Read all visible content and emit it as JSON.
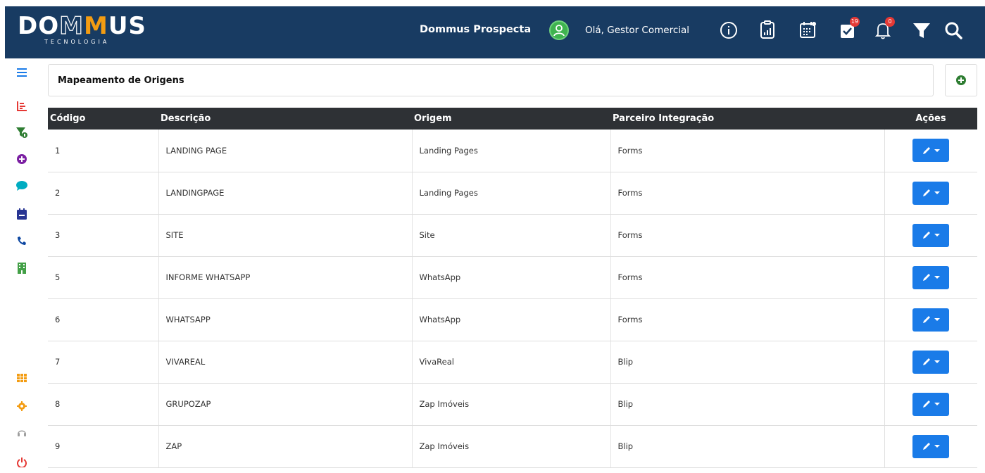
{
  "header": {
    "logo_main_pre": "DO",
    "logo_main_m1": "M",
    "logo_main_m2": "M",
    "logo_main_post": "US",
    "logo_sub": "TECNOLOGIA",
    "app_name": "Dommus Prospecta",
    "greeting": "Olá, Gestor Comercial",
    "icons": [
      "user-avatar-icon",
      "info-icon",
      "report-icon",
      "calendar-icon",
      "task-check-icon",
      "bell-icon",
      "filter-icon",
      "search-icon"
    ],
    "task_badge": "19",
    "notif_badge": "0"
  },
  "sidebar": {
    "items": [
      {
        "icon": "menu-icon",
        "color": "#1a7be8"
      },
      {
        "icon": "chart-icon",
        "color": "#e53935"
      },
      {
        "icon": "funnel-icon",
        "color": "#2e7d32"
      },
      {
        "icon": "plus-circle-icon",
        "color": "#7b1fa2"
      },
      {
        "icon": "chat-icon",
        "color": "#00acc1"
      },
      {
        "icon": "calendar-icon",
        "color": "#283593"
      },
      {
        "icon": "phone-icon",
        "color": "#0d47a1"
      },
      {
        "icon": "building-icon",
        "color": "#43a047"
      },
      {
        "icon": "table-icon",
        "color": "#f39c12"
      },
      {
        "icon": "gear-icon",
        "color": "#f39c12"
      },
      {
        "icon": "headset-icon",
        "color": "#9e9e9e"
      },
      {
        "icon": "power-icon",
        "color": "#e53935"
      }
    ]
  },
  "page": {
    "title": "Mapeamento de Origens"
  },
  "table": {
    "headers": [
      "Código",
      "Descrição",
      "Origem",
      "Parceiro Integração",
      "Ações"
    ],
    "rows": [
      {
        "codigo": "1",
        "descricao": "LANDING PAGE",
        "origem": "Landing Pages",
        "parceiro": "Forms"
      },
      {
        "codigo": "2",
        "descricao": "LANDINGPAGE",
        "origem": "Landing Pages",
        "parceiro": "Forms"
      },
      {
        "codigo": "3",
        "descricao": "SITE",
        "origem": "Site",
        "parceiro": "Forms"
      },
      {
        "codigo": "5",
        "descricao": "INFORME WHATSAPP",
        "origem": "WhatsApp",
        "parceiro": "Forms"
      },
      {
        "codigo": "6",
        "descricao": "WHATSAPP",
        "origem": "WhatsApp",
        "parceiro": "Forms"
      },
      {
        "codigo": "7",
        "descricao": "VIVAREAL",
        "origem": "VivaReal",
        "parceiro": "Blip"
      },
      {
        "codigo": "8",
        "descricao": "GRUPOZAP",
        "origem": "Zap Imóveis",
        "parceiro": "Blip"
      },
      {
        "codigo": "9",
        "descricao": "ZAP",
        "origem": "Zap Imóveis",
        "parceiro": "Blip"
      }
    ]
  },
  "colors": {
    "header_bg": "#183b62",
    "table_header_bg": "#2e3135",
    "edit_button": "#1a7be8",
    "add_button": "#2e7d32"
  }
}
